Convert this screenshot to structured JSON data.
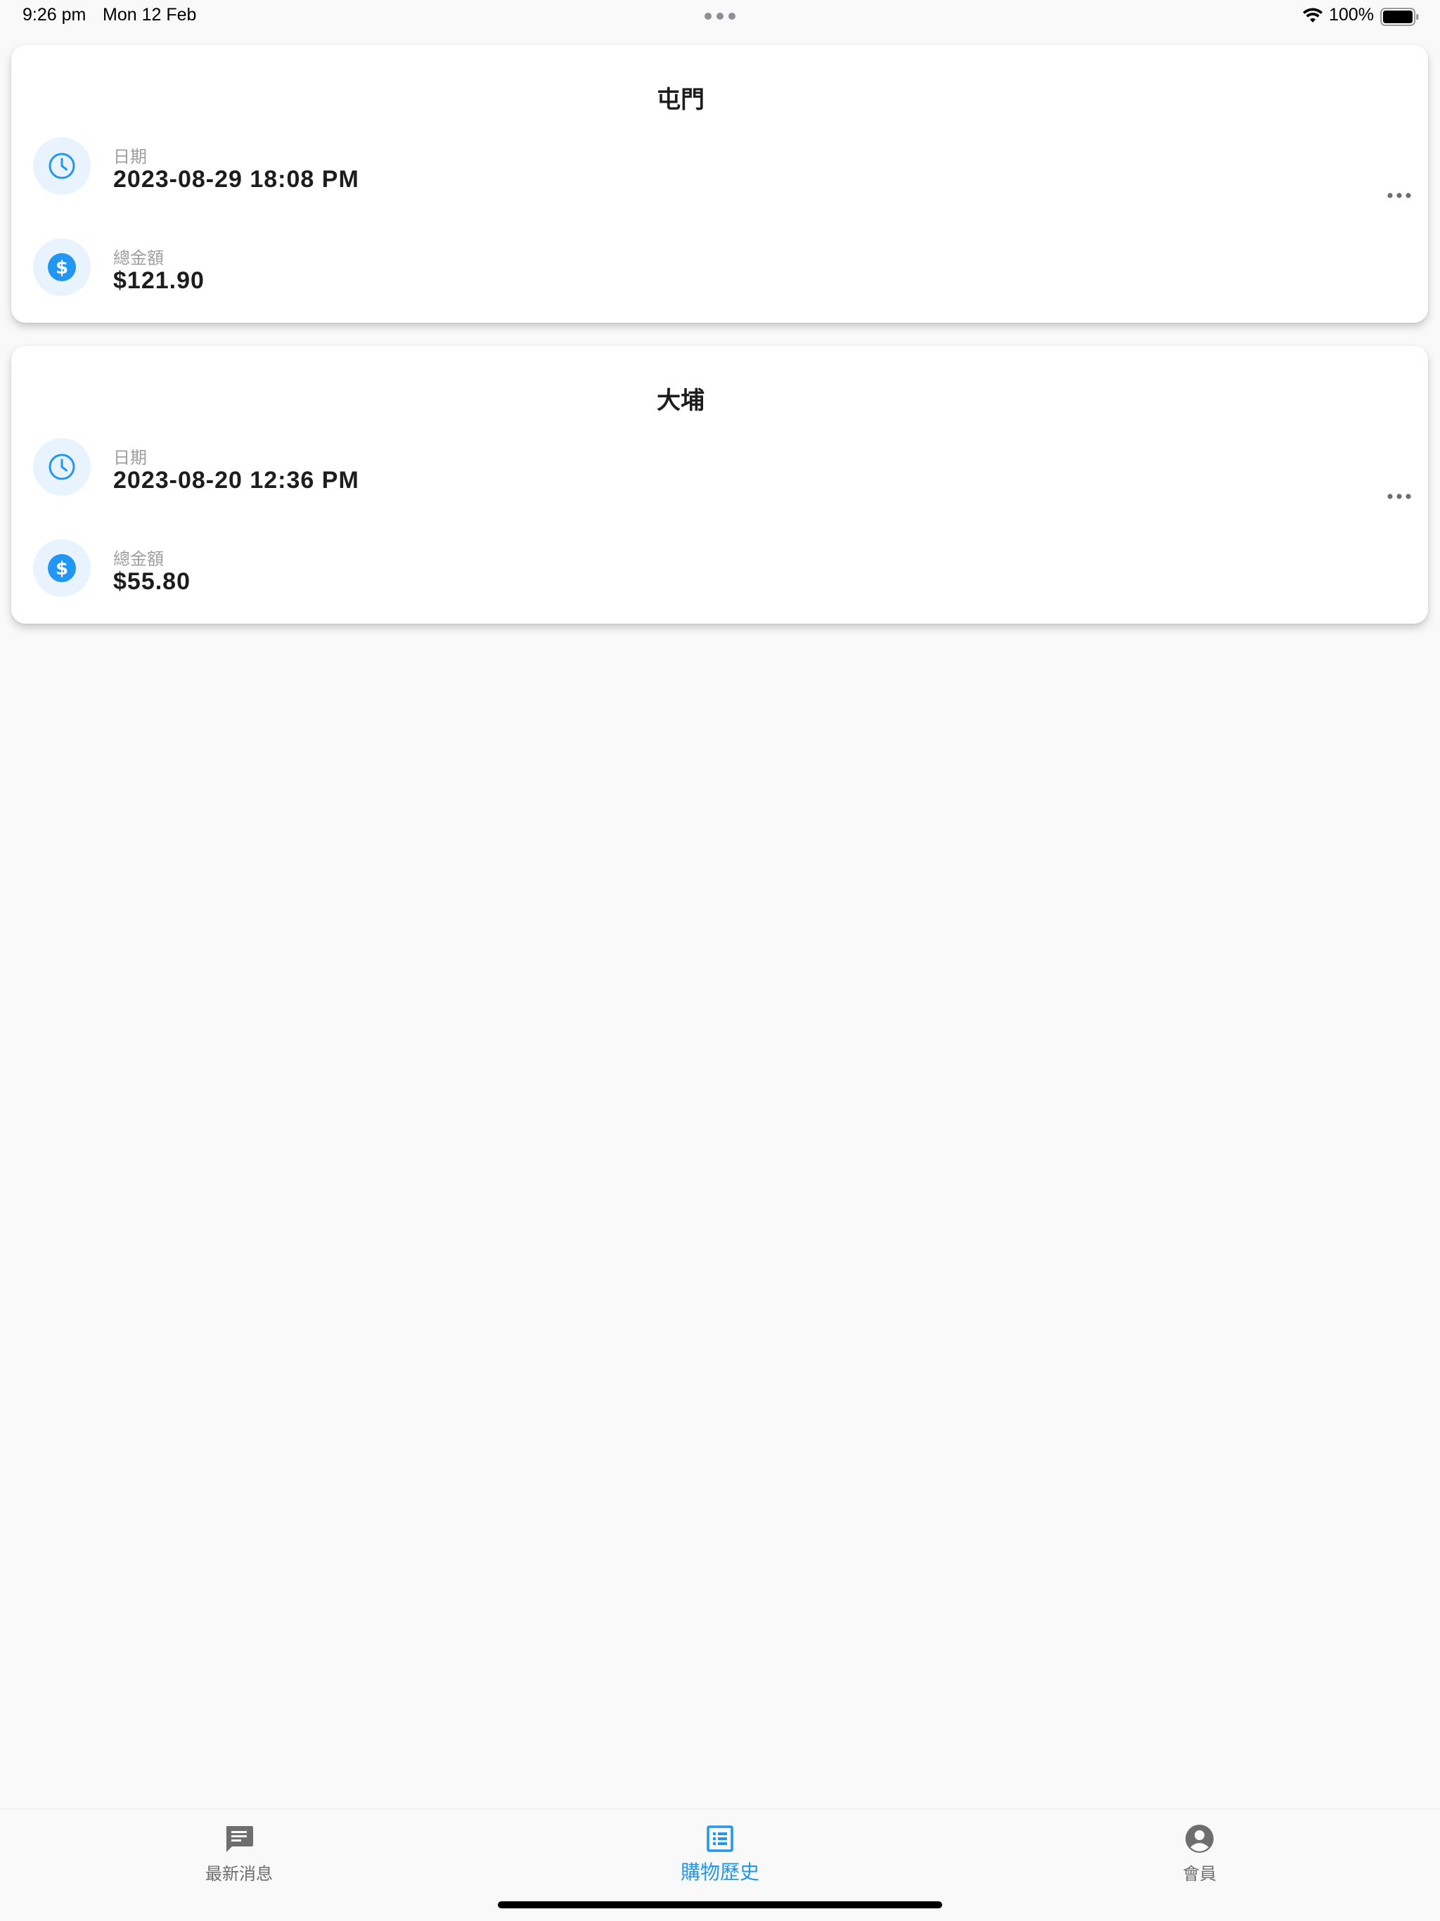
{
  "status_bar": {
    "time": "9:26 pm",
    "date": "Mon 12 Feb",
    "battery": "100%"
  },
  "purchases": [
    {
      "store": "屯門",
      "date_label": "日期",
      "date_value": "2023-08-29 18:08 PM",
      "amount_label": "總金額",
      "amount_value": "$121.90"
    },
    {
      "store": "大埔",
      "date_label": "日期",
      "date_value": "2023-08-20 12:36 PM",
      "amount_label": "總金額",
      "amount_value": "$55.80"
    }
  ],
  "tabs": [
    {
      "label": "最新消息",
      "icon": "message-icon",
      "active": false
    },
    {
      "label": "購物歷史",
      "icon": "list-icon",
      "active": true
    },
    {
      "label": "會員",
      "icon": "account-icon",
      "active": false
    }
  ],
  "colors": {
    "accent": "#2196f3",
    "icon_bg": "#e8f3fd",
    "inactive": "#6e6e6e",
    "label": "#9e9e9e"
  }
}
